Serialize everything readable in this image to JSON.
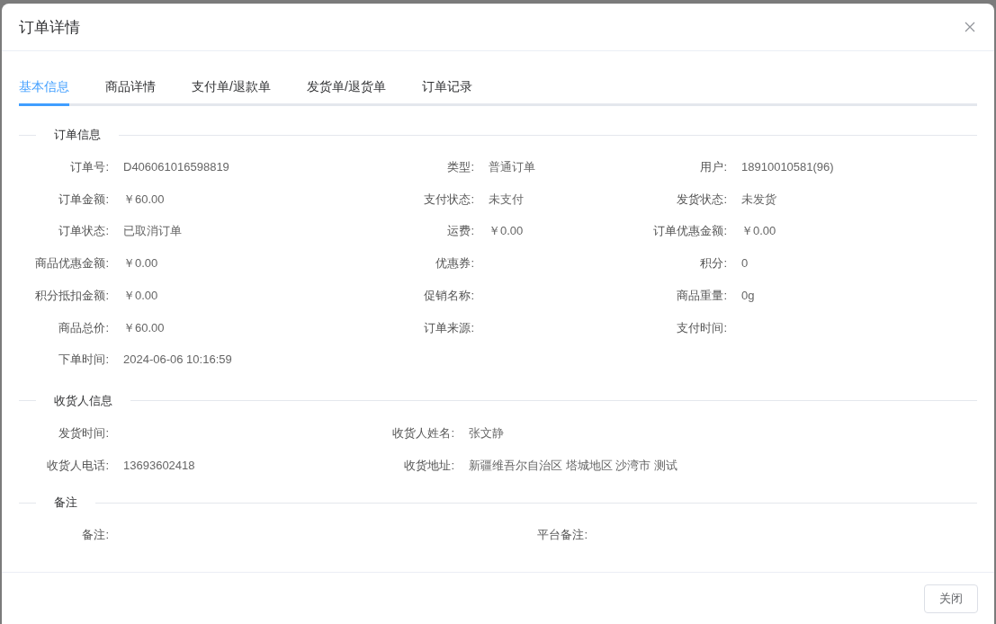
{
  "dialog": {
    "title": "订单详情",
    "footer_button": "关闭"
  },
  "tabs": [
    {
      "label": "基本信息",
      "selected": true
    },
    {
      "label": "商品详情",
      "selected": false
    },
    {
      "label": "支付单/退款单",
      "selected": false
    },
    {
      "label": "发货单/退货单",
      "selected": false
    },
    {
      "label": "订单记录",
      "selected": false
    }
  ],
  "sections": [
    {
      "title": "订单信息",
      "fields": [
        {
          "label": "订单号:",
          "value": "D406061016598819"
        },
        {
          "label": "类型:",
          "value": "普通订单"
        },
        {
          "label": "用户:",
          "value": "18910010581(96)"
        },
        {
          "label": "订单金额:",
          "value": "￥60.00"
        },
        {
          "label": "支付状态:",
          "value": "未支付"
        },
        {
          "label": "发货状态:",
          "value": "未发货"
        },
        {
          "label": "订单状态:",
          "value": "已取消订单"
        },
        {
          "label": "运费:",
          "value": "￥0.00"
        },
        {
          "label": "订单优惠金额:",
          "value": "￥0.00"
        },
        {
          "label": "商品优惠金额:",
          "value": "￥0.00"
        },
        {
          "label": "优惠券:"
        },
        {
          "label": "积分:",
          "value": "0"
        },
        {
          "label": "积分抵扣金额:",
          "value": "￥0.00"
        },
        {
          "label": "促销名称:"
        },
        {
          "label": "商品重量:",
          "value": "0g"
        },
        {
          "label": "商品总价:",
          "value": "￥60.00"
        },
        {
          "label": "订单来源:"
        },
        {
          "label": "支付时间:"
        },
        {
          "label": "下单时间:",
          "value": "2024-06-06 10:16:59"
        }
      ]
    },
    {
      "title": "收货人信息",
      "fields": [
        {
          "label": "发货时间:"
        },
        {
          "label": "收货人姓名:",
          "value": "张文静"
        },
        {
          "label": "收货人电话:",
          "value": "13693602418"
        },
        {
          "label": "收货地址:",
          "value": "新疆维吾尔自治区 塔城地区 沙湾市 测试"
        }
      ]
    },
    {
      "title": "备注",
      "fields": [
        {
          "label": "备注:"
        },
        {
          "label": "平台备注:"
        }
      ]
    }
  ]
}
